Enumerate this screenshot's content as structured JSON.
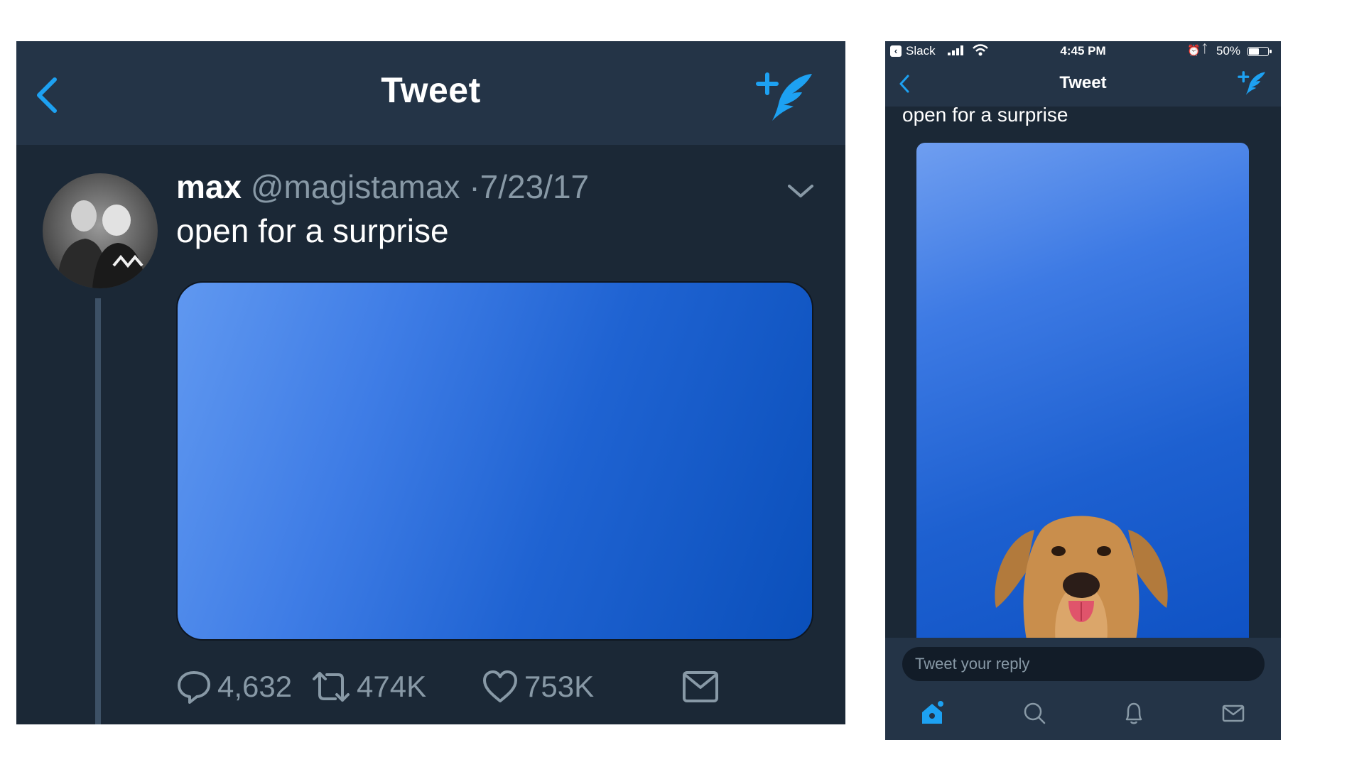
{
  "left_panel": {
    "header": {
      "title": "Tweet"
    },
    "tweet": {
      "name": "max",
      "handle": "@magistamax",
      "separator": "·",
      "date": "7/23/17",
      "text": "open for a surprise"
    },
    "actions": {
      "replies": "4,632",
      "retweets": "474K",
      "likes": "753K"
    }
  },
  "right_panel": {
    "status_bar": {
      "back_app": "Slack",
      "time": "4:45 PM",
      "battery": "50%"
    },
    "header": {
      "title": "Tweet"
    },
    "tweet": {
      "text": "open for a surprise"
    },
    "reply": {
      "placeholder": "Tweet your reply"
    },
    "tabs": [
      "home-icon",
      "search-icon",
      "notifications-icon",
      "messages-icon"
    ]
  },
  "colors": {
    "background": "#1b2836",
    "header": "#243447",
    "accent": "#1da1f2",
    "muted": "#8899a6"
  }
}
